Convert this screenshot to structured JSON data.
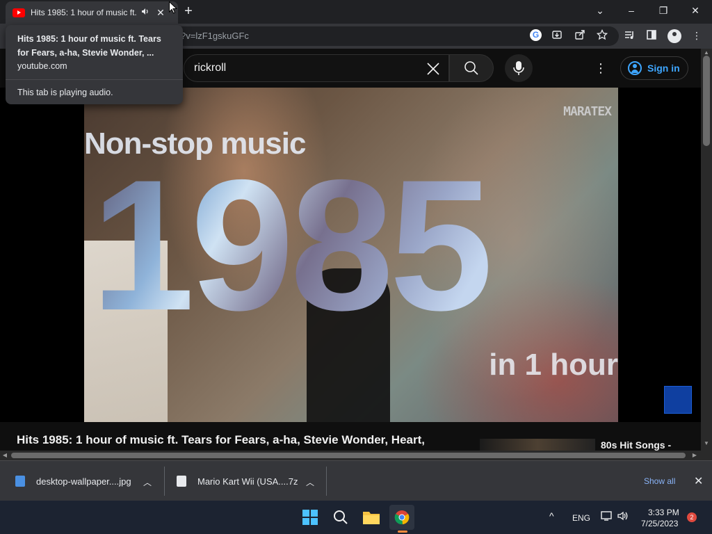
{
  "browser": {
    "tab": {
      "title": "Hits 1985: 1 hour of music ft. Tears for Fears, a-ha, Stevie Wonder, Heart, ...",
      "audio_icon": "speaker-icon",
      "close_glyph": "✕"
    },
    "new_tab_glyph": "+",
    "window_controls": {
      "dropdown": "⌄",
      "minimize": "–",
      "restore": "❐",
      "close": "✕"
    },
    "address_bar": {
      "url_fragment": "?v=lzF1gskuGFc"
    },
    "hover_card": {
      "title": "Hits 1985: 1 hour of music ft. Tears for Fears, a-ha, Stevie Wonder, ...",
      "domain": "youtube.com",
      "audio_status": "This tab is playing audio."
    }
  },
  "youtube": {
    "search": {
      "value": "rickroll",
      "clear_glyph": "✕"
    },
    "sign_in_label": "Sign in",
    "more_glyph": "⋮"
  },
  "video": {
    "overlay_top": "Non-stop music",
    "year": "1985",
    "overlay_bottom": "in 1 hour",
    "watermark": "MARATEX",
    "title": "Hits 1985: 1 hour of music ft. Tears for Fears, a-ha, Stevie Wonder, Heart,",
    "recommendation_title": "80s Hit Songs -"
  },
  "downloads": {
    "items": [
      {
        "name": "desktop-wallpaper....jpg"
      },
      {
        "name": "Mario Kart Wii (USA....7z"
      }
    ],
    "show_all": "Show all",
    "close_glyph": "✕"
  },
  "taskbar": {
    "language": "ENG",
    "time": "3:33 PM",
    "date": "7/25/2023",
    "notification_count": "2",
    "chevron": "^"
  },
  "colors": {
    "accent_blue": "#3ea6ff",
    "youtube_red": "#ff0000",
    "chrome_bg": "#202124",
    "toolbar_bg": "#35363a"
  }
}
